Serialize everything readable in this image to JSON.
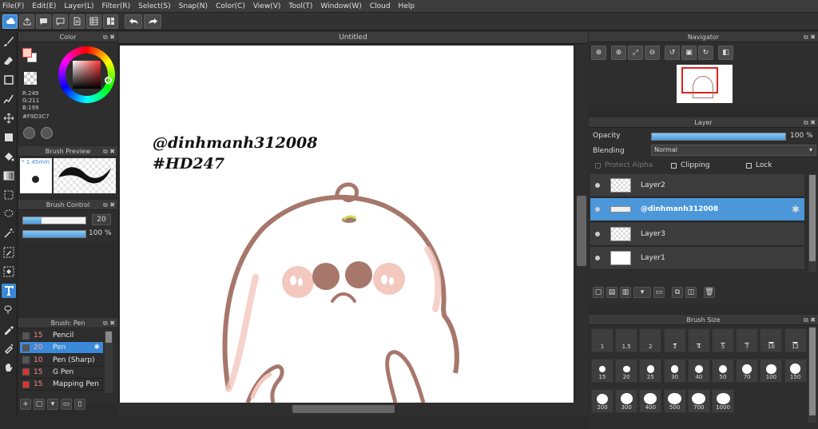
{
  "menu": [
    "File(F)",
    "Edit(E)",
    "Layer(L)",
    "Filter(R)",
    "Select(S)",
    "Snap(N)",
    "Color(C)",
    "View(V)",
    "Tool(T)",
    "Window(W)",
    "Cloud",
    "Help"
  ],
  "document": {
    "title": "Untitled"
  },
  "color_panel": {
    "title": "Color",
    "r": "R:249",
    "g": "G:211",
    "b": "B:199",
    "hex": "#F9D3C7",
    "primary_color": "#f9d3c7",
    "secondary_color": "#ffffff"
  },
  "brush_preview": {
    "title": "Brush Preview",
    "size": "* 1.45mm"
  },
  "brush_control": {
    "title": "Brush Control",
    "size_value": "20",
    "opacity_value": "100 %",
    "size_fraction": 0.3,
    "opacity_fraction": 1.0
  },
  "brush_list": {
    "title": "Brush: Pen",
    "items": [
      {
        "num": "15",
        "name": "Pencil",
        "color": "#555555"
      },
      {
        "num": "20",
        "name": "Pen",
        "color": "#555555",
        "selected": true
      },
      {
        "num": "10",
        "name": "Pen (Sharp)",
        "color": "#555555"
      },
      {
        "num": "15",
        "name": "G Pen",
        "color": "#e03030"
      },
      {
        "num": "15",
        "name": "Mapping Pen",
        "color": "#e03030"
      }
    ]
  },
  "canvas": {
    "text1": "@dinhmanh312008",
    "text2": "#HD247"
  },
  "navigator": {
    "title": "Navigator"
  },
  "layer_panel": {
    "title": "Layer",
    "opacity_label": "Opacity",
    "opacity_value": "100 %",
    "opacity_fraction": 1.0,
    "blending_label": "Blending",
    "blending_value": "Normal",
    "protect_alpha": "Protect Alpha",
    "clipping": "Clipping",
    "lock": "Lock",
    "layers": [
      {
        "name": "Layer2",
        "selected": false
      },
      {
        "name": "@dinhmanh312008",
        "selected": true
      },
      {
        "name": "Layer3",
        "selected": false
      },
      {
        "name": "Layer1",
        "selected": false
      }
    ]
  },
  "brush_size": {
    "title": "Brush Size",
    "sizes": [
      "1",
      "1.5",
      "2",
      "3",
      "4",
      "5",
      "7",
      "10",
      "12",
      "15",
      "20",
      "25",
      "30",
      "40",
      "50",
      "70",
      "100",
      "150",
      "200",
      "300",
      "400",
      "500",
      "700",
      "1000"
    ]
  },
  "icons": [
    "brush-icon",
    "eraser-icon",
    "rect-icon",
    "pen-icon",
    "move-icon",
    "fill-rect-icon",
    "bucket-icon",
    "gradient-icon",
    "select-rect-icon",
    "lasso-icon",
    "wand-icon",
    "select-pen-icon",
    "select-eraser-icon",
    "text-icon",
    "hand-icon",
    "eyedropper-icon"
  ]
}
